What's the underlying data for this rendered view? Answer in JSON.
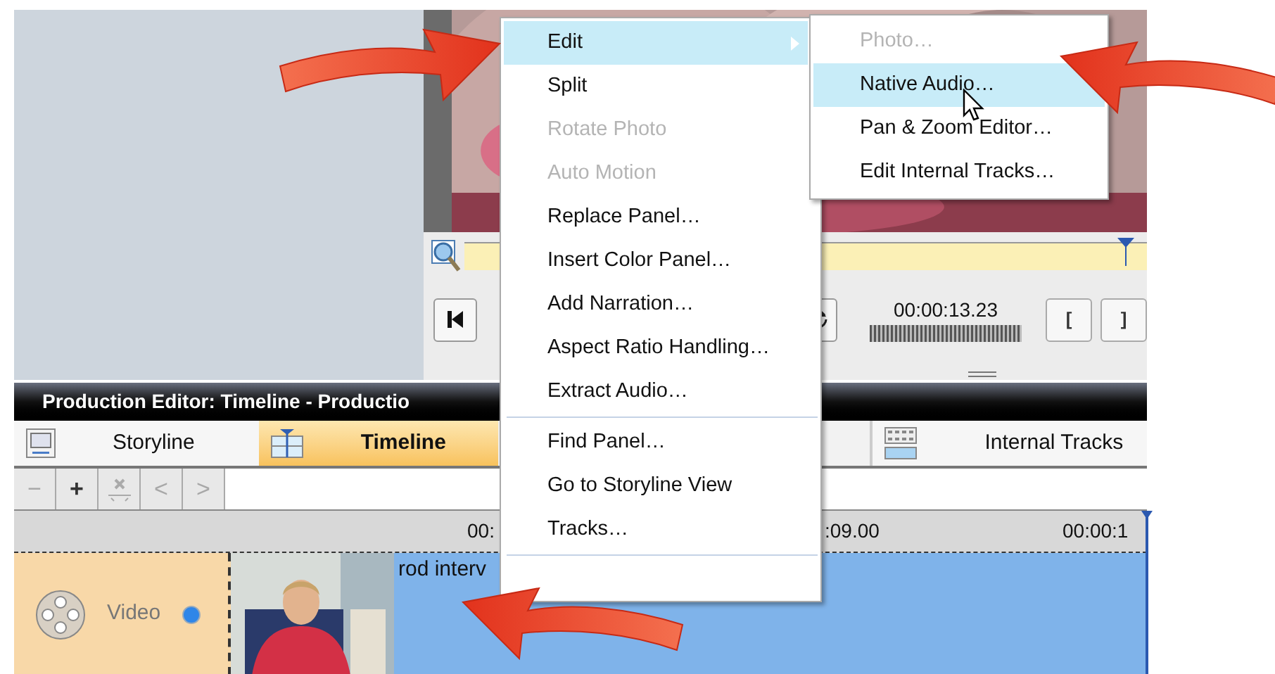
{
  "preview": {
    "playhead": {
      "level": 0.97
    },
    "timecode": "00:00:13.23",
    "buttons": [
      {
        "label": "["
      },
      {
        "label": "]"
      }
    ]
  },
  "title_bar": {
    "title": "Production Editor: Timeline - Productio"
  },
  "tabs": [
    {
      "label": "Storyline",
      "selected": false,
      "kind": "storyline"
    },
    {
      "label": "Timeline",
      "selected": true,
      "kind": "timeline"
    },
    {
      "label": "Internal Tracks",
      "selected": false,
      "kind": "tracks"
    }
  ],
  "toolbar": [
    {
      "kind": "text",
      "label": "−",
      "disabled": true
    },
    {
      "kind": "text",
      "label": "+",
      "disabled": false
    },
    {
      "kind": "delete",
      "disabled": true
    },
    {
      "kind": "text",
      "label": "<",
      "disabled": true
    },
    {
      "kind": "text",
      "label": ">",
      "disabled": true
    }
  ],
  "ruler": {
    "labels": [
      "00:",
      ":09.00",
      "00:00:1"
    ]
  },
  "track": {
    "label": "Video",
    "clip_title": "rod interv"
  },
  "context_menu": {
    "items": [
      {
        "kind": "item",
        "label": "Edit",
        "selected": true,
        "disabled": false,
        "submenu": true
      },
      {
        "kind": "item",
        "label": "Split",
        "selected": false,
        "disabled": false,
        "submenu": false
      },
      {
        "kind": "item",
        "label": "Rotate Photo",
        "selected": false,
        "disabled": true,
        "submenu": false
      },
      {
        "kind": "item",
        "label": "Auto Motion",
        "selected": false,
        "disabled": true,
        "submenu": false
      },
      {
        "kind": "item",
        "label": "Replace Panel…",
        "selected": false,
        "disabled": false,
        "submenu": false
      },
      {
        "kind": "item",
        "label": "Insert Color Panel…",
        "selected": false,
        "disabled": false,
        "submenu": false
      },
      {
        "kind": "item",
        "label": "Add Narration…",
        "selected": false,
        "disabled": false,
        "submenu": false
      },
      {
        "kind": "item",
        "label": "Aspect Ratio Handling…",
        "selected": false,
        "disabled": false,
        "submenu": false
      },
      {
        "kind": "item",
        "label": "Extract Audio…",
        "selected": false,
        "disabled": false,
        "submenu": false
      },
      {
        "kind": "separator"
      },
      {
        "kind": "item",
        "label": "Find Panel…",
        "selected": false,
        "disabled": false,
        "submenu": false
      },
      {
        "kind": "item",
        "label": "Go to Storyline View",
        "selected": false,
        "disabled": false,
        "submenu": false
      },
      {
        "kind": "item",
        "label": "Tracks…",
        "selected": false,
        "disabled": false,
        "submenu": false
      },
      {
        "kind": "separator"
      }
    ]
  },
  "submenu": {
    "items": [
      {
        "label": "Photo…",
        "selected": false,
        "disabled": true
      },
      {
        "label": "Native Audio…",
        "selected": true,
        "disabled": false
      },
      {
        "label": "Pan & Zoom Editor…",
        "selected": false,
        "disabled": false
      },
      {
        "label": "Edit Internal Tracks…",
        "selected": false,
        "disabled": false
      }
    ]
  }
}
